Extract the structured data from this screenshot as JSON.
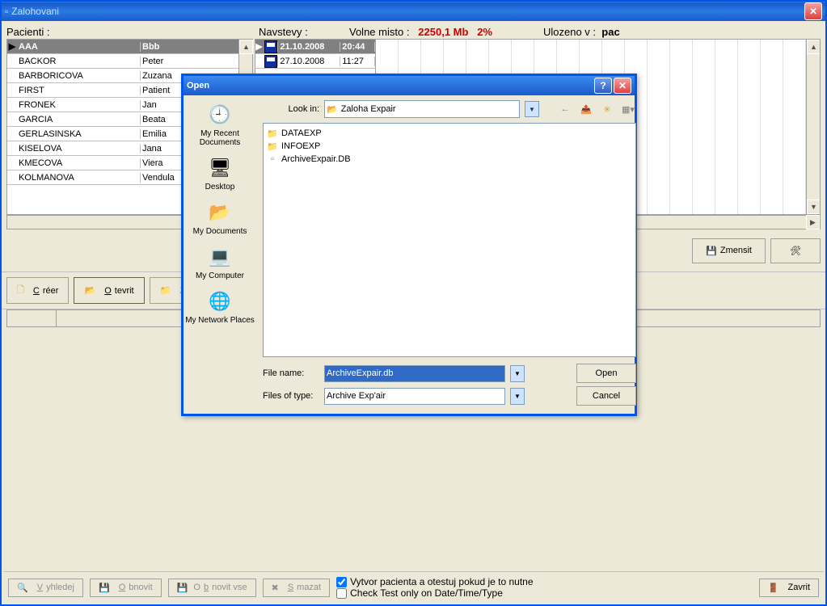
{
  "window": {
    "title": "Zalohovani"
  },
  "header": {
    "pacienti_label": "Pacienti :",
    "navstevy_label": "Navstevy :",
    "volne_misto_label": "Volne misto :",
    "volne_misto_value": "2250,1 Mb",
    "volne_misto_pct": "2%",
    "ulozeno_label": "Ulozeno v :",
    "ulozeno_value": "pac"
  },
  "patients": [
    {
      "surname": "AAA",
      "name": "Bbb",
      "selected": true
    },
    {
      "surname": "BACKOR",
      "name": "Peter"
    },
    {
      "surname": "BARBORICOVA",
      "name": "Zuzana"
    },
    {
      "surname": "FIRST",
      "name": "Patient"
    },
    {
      "surname": "FRONEK",
      "name": "Jan"
    },
    {
      "surname": "GARCIA",
      "name": "Beata"
    },
    {
      "surname": "GERLASINSKA",
      "name": "Emilia"
    },
    {
      "surname": "KISELOVA",
      "name": "Jana"
    },
    {
      "surname": "KMECOVA",
      "name": "Viera"
    },
    {
      "surname": "KOLMANOVA",
      "name": "Vendula"
    }
  ],
  "visits": [
    {
      "date": "21.10.2008",
      "time": "20:44",
      "selected": true
    },
    {
      "date": "27.10.2008",
      "time": "11:27"
    }
  ],
  "midbar": {
    "zmensit_label": "Zmensit"
  },
  "toolbar": {
    "creer": "Créer",
    "otevrit": "Otevrit",
    "z": "Z..."
  },
  "bottom": {
    "vyhledej": "Vyhledej",
    "obnovit": "Obnovit",
    "obnovit_vse": "Obnovit vse",
    "smazat": "Smazat",
    "check1": "Vytvor pacienta a otestuj pokud je to nutne",
    "check2": "Check Test only on Date/Time/Type",
    "zavrit": "Zavrit"
  },
  "dialog": {
    "title": "Open",
    "lookin_label": "Look in:",
    "lookin_value": "Zaloha Expair",
    "places": {
      "recent": "My Recent Documents",
      "desktop": "Desktop",
      "mydocs": "My Documents",
      "mycomp": "My Computer",
      "network": "My Network Places"
    },
    "files": [
      {
        "name": "DATAEXP",
        "type": "folder"
      },
      {
        "name": "INFOEXP",
        "type": "folder"
      },
      {
        "name": "ArchiveExpair.DB",
        "type": "db"
      }
    ],
    "filename_label": "File name:",
    "filename_value": "ArchiveExpair.db",
    "filetype_label": "Files of type:",
    "filetype_value": "Archive Exp'air",
    "open_btn": "Open",
    "cancel_btn": "Cancel"
  }
}
